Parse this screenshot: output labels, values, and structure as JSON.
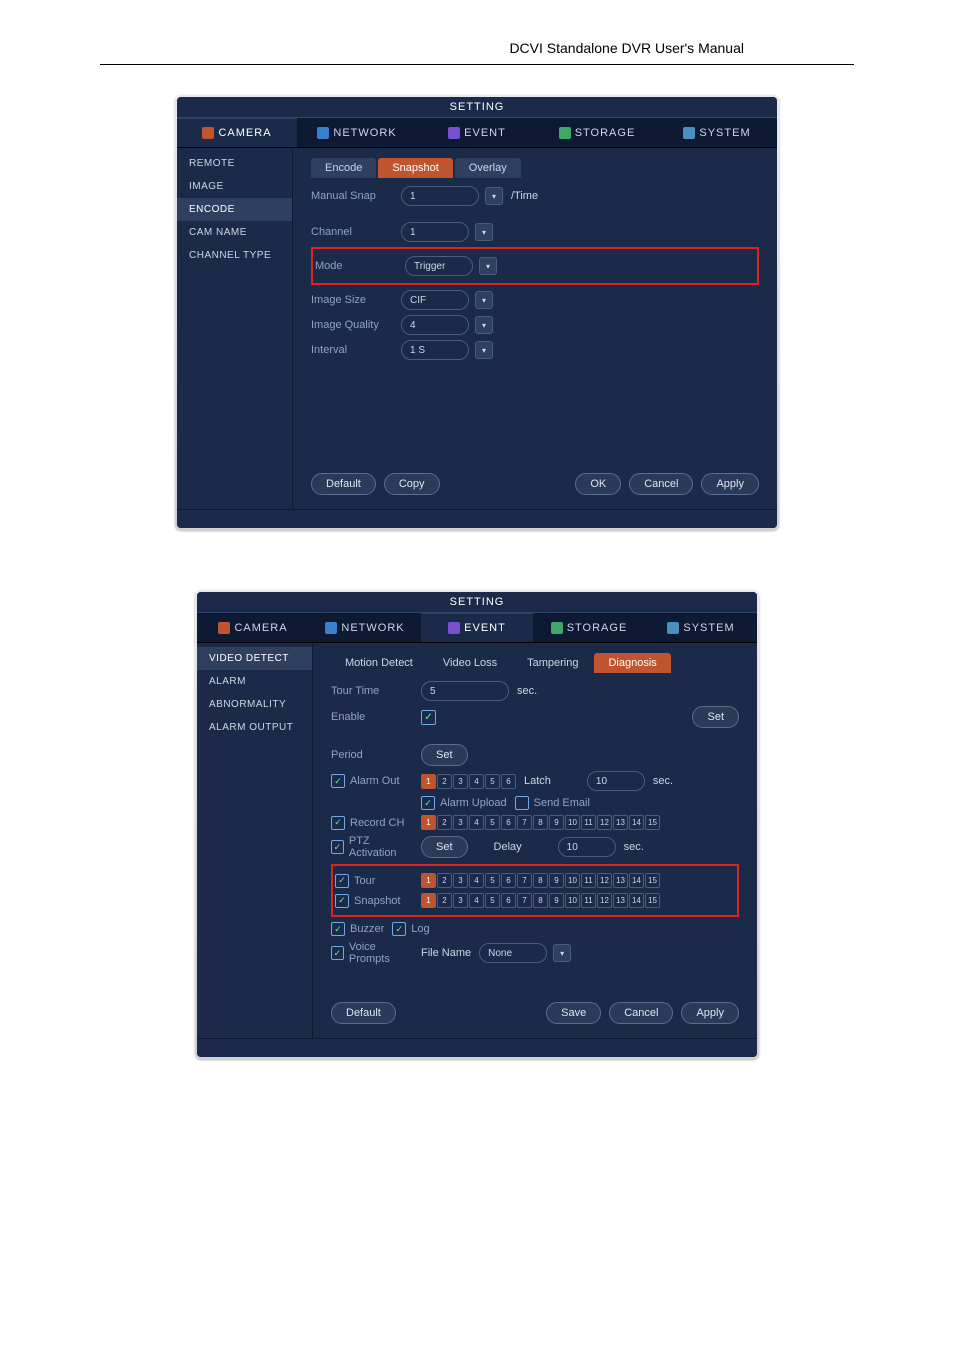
{
  "headerTitle": "DCVI Standalone DVR User's Manual",
  "shared": {
    "settingTitle": "SETTING",
    "nav": {
      "camera": "CAMERA",
      "network": "NETWORK",
      "event": "EVENT",
      "storage": "STORAGE",
      "system": "SYSTEM"
    },
    "buttons": {
      "default": "Default",
      "copy": "Copy",
      "ok": "OK",
      "cancel": "Cancel",
      "apply": "Apply",
      "set": "Set",
      "save": "Save"
    }
  },
  "s1": {
    "sidebar": {
      "remote": "REMOTE",
      "image": "IMAGE",
      "encode": "ENCODE",
      "camName": "CAM NAME",
      "channelType": "CHANNEL TYPE"
    },
    "subtabs": {
      "encode": "Encode",
      "snapshot": "Snapshot",
      "overlay": "Overlay"
    },
    "form": {
      "manualSnapLabel": "Manual Snap",
      "manualSnapValue": "1",
      "manualSnapUnit": "/Time",
      "channelLabel": "Channel",
      "channelValue": "1",
      "modeLabel": "Mode",
      "modeValue": "Trigger",
      "imageSizeLabel": "Image Size",
      "imageSizeValue": "CIF",
      "imageQualityLabel": "Image Quality",
      "imageQualityValue": "4",
      "intervalLabel": "Interval",
      "intervalValue": "1 S"
    }
  },
  "s2": {
    "sidebar": {
      "videoDetect": "VIDEO DETECT",
      "alarm": "ALARM",
      "abnormality": "ABNORMALITY",
      "alarmOutput": "ALARM OUTPUT"
    },
    "subtabs": {
      "motion": "Motion Detect",
      "videoLoss": "Video Loss",
      "tampering": "Tampering",
      "diagnosis": "Diagnosis"
    },
    "form": {
      "tourTimeLabel": "Tour Time",
      "tourTimeValue": "5",
      "tourTimeUnit": "sec.",
      "enableLabel": "Enable",
      "periodLabel": "Period",
      "alarmOutLabel": "Alarm Out",
      "latchLabel": "Latch",
      "latchValue": "10",
      "latchUnit": "sec.",
      "alarmUploadLabel": "Alarm Upload",
      "sendEmailLabel": "Send Email",
      "recordChLabel": "Record CH",
      "ptzLabel": "PTZ Activation",
      "delayLabel": "Delay",
      "delayValue": "10",
      "delayUnit": "sec.",
      "tourLabel": "Tour",
      "snapshotLabel": "Snapshot",
      "buzzerLabel": "Buzzer",
      "logLabel": "Log",
      "voicePromptsLabel": "Voice Prompts",
      "fileNameLabel": "File Name",
      "fileNameValue": "None"
    }
  }
}
